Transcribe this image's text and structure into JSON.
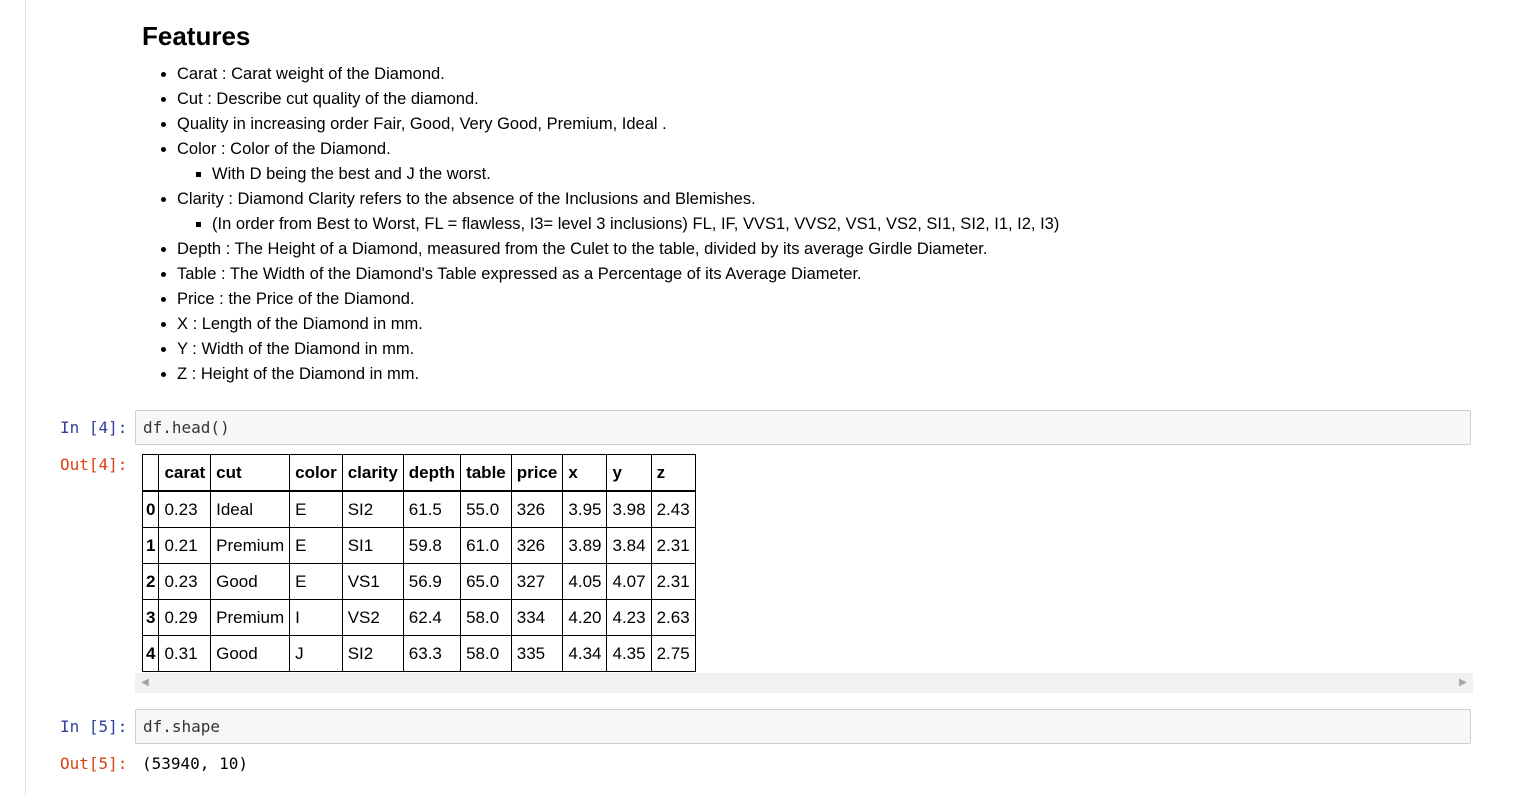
{
  "markdown": {
    "heading": "Features",
    "items": [
      {
        "text": "Carat : Carat weight of the Diamond."
      },
      {
        "text": "Cut : Describe cut quality of the diamond."
      },
      {
        "text": "Quality in increasing order Fair, Good, Very Good, Premium, Ideal ."
      },
      {
        "text": "Color : Color of the Diamond."
      },
      {
        "text": "With D being the best and J the worst."
      },
      {
        "text": "Clarity : Diamond Clarity refers to the absence of the Inclusions and Blemishes."
      },
      {
        "text": "(In order from Best to Worst, FL = flawless, I3= level 3 inclusions) FL, IF, VVS1, VVS2, VS1, VS2, SI1, SI2, I1, I2, I3)"
      },
      {
        "text": "Depth : The Height of a Diamond, measured from the Culet to the table, divided by its average Girdle Diameter."
      },
      {
        "text": "Table : The Width of the Diamond's Table expressed as a Percentage of its Average Diameter."
      },
      {
        "text": "Price : the Price of the Diamond."
      },
      {
        "text": "X : Length of the Diamond in mm."
      },
      {
        "text": "Y : Width of the Diamond in mm."
      },
      {
        "text": "Z : Height of the Diamond in mm."
      }
    ]
  },
  "cell4": {
    "in_prompt": "In [4]:",
    "code": "df.head()",
    "out_prompt": "Out[4]:",
    "table": {
      "columns": [
        "carat",
        "cut",
        "color",
        "clarity",
        "depth",
        "table",
        "price",
        "x",
        "y",
        "z"
      ],
      "rows": [
        {
          "index": "0",
          "cells": [
            "0.23",
            "Ideal",
            "E",
            "SI2",
            "61.5",
            "55.0",
            "326",
            "3.95",
            "3.98",
            "2.43"
          ]
        },
        {
          "index": "1",
          "cells": [
            "0.21",
            "Premium",
            "E",
            "SI1",
            "59.8",
            "61.0",
            "326",
            "3.89",
            "3.84",
            "2.31"
          ]
        },
        {
          "index": "2",
          "cells": [
            "0.23",
            "Good",
            "E",
            "VS1",
            "56.9",
            "65.0",
            "327",
            "4.05",
            "4.07",
            "2.31"
          ]
        },
        {
          "index": "3",
          "cells": [
            "0.29",
            "Premium",
            "I",
            "VS2",
            "62.4",
            "58.0",
            "334",
            "4.20",
            "4.23",
            "2.63"
          ]
        },
        {
          "index": "4",
          "cells": [
            "0.31",
            "Good",
            "J",
            "SI2",
            "63.3",
            "58.0",
            "335",
            "4.34",
            "4.35",
            "2.75"
          ]
        }
      ]
    }
  },
  "cell5": {
    "in_prompt": "In [5]:",
    "code": "df.shape",
    "out_prompt": "Out[5]:",
    "output": "(53940, 10)"
  },
  "colors": {
    "in_prompt": "#303f9f",
    "out_prompt": "#d84315",
    "code_bg": "#f7f7f7"
  }
}
